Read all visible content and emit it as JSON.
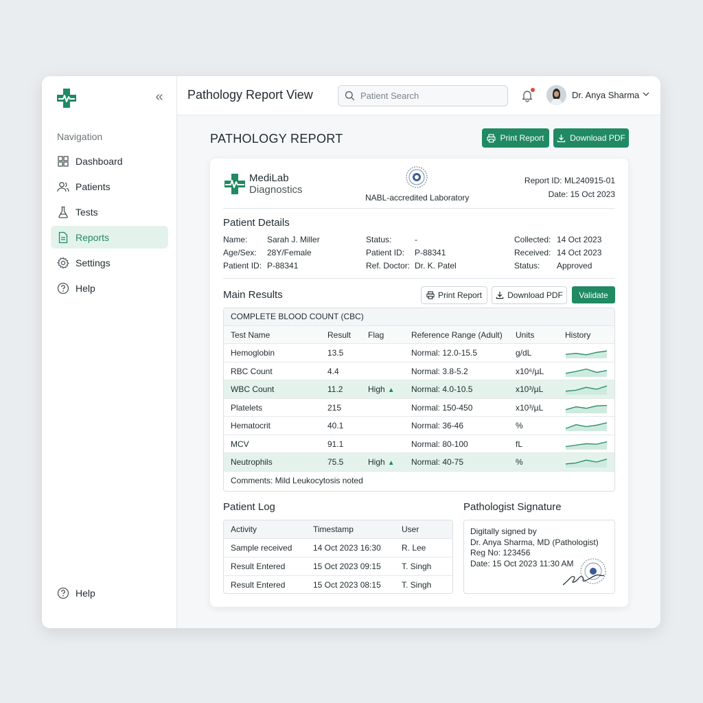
{
  "app": {
    "page_title": "Pathology Report View",
    "search_placeholder": "Patient Search",
    "user_name": "Dr. Anya Sharma",
    "accent_color": "#1f8a63"
  },
  "sidebar": {
    "heading": "Navigation",
    "items": [
      {
        "label": "Dashboard",
        "icon": "grid-icon"
      },
      {
        "label": "Patients",
        "icon": "users-icon"
      },
      {
        "label": "Tests",
        "icon": "flask-icon"
      },
      {
        "label": "Reports",
        "icon": "document-icon",
        "active": true
      },
      {
        "label": "Settings",
        "icon": "gear-icon"
      },
      {
        "label": "Help",
        "icon": "help-icon"
      }
    ],
    "footer_help": "Help"
  },
  "report": {
    "heading": "PATHOLOGY REPORT",
    "print_label": "Print Report",
    "download_label": "Download PDF",
    "lab_name_1": "MediLab",
    "lab_name_2": "Diagnostics",
    "accreditation": "NABL-accredited Laboratory",
    "report_id": "Report ID: ML240915-01",
    "date": "Date: 15 Oct 2023"
  },
  "patient": {
    "title": "Patient Details",
    "col1": [
      {
        "k": "Name:",
        "v": "Sarah J. Miller"
      },
      {
        "k": "Age/Sex:",
        "v": "28Y/Female"
      },
      {
        "k": "Patient ID:",
        "v": "P-88341"
      }
    ],
    "col2": [
      {
        "k": "Status:",
        "v": "-"
      },
      {
        "k": "Patient ID:",
        "v": "P-88341"
      },
      {
        "k": "Ref. Doctor:",
        "v": "Dr. K. Patel"
      }
    ],
    "col3": [
      {
        "k": "Collected:",
        "v": "14 Oct 2023"
      },
      {
        "k": "Received:",
        "v": "14 Oct 2023"
      },
      {
        "k": "Status:",
        "v": "Approved"
      }
    ]
  },
  "results": {
    "title": "Main Results",
    "print_label": "Print Report",
    "download_label": "Download PDF",
    "validate_label": "Validate",
    "panel_title": "COMPLETE BLOOD COUNT (CBC)",
    "headers": [
      "Test Name",
      "Result",
      "Flag",
      "Reference Range (Adult)",
      "Units",
      "History"
    ],
    "rows": [
      {
        "name": "Hemoglobin",
        "result": "13.5",
        "flag": "",
        "range": "Normal: 12.0-15.5",
        "units": "g/dL",
        "highlight": false,
        "history": [
          0.35,
          0.45,
          0.3,
          0.55,
          0.7
        ]
      },
      {
        "name": "RBC Count",
        "result": "4.4",
        "flag": "",
        "range": "Normal: 3.8-5.2",
        "units": "x10⁶/µL",
        "highlight": false,
        "history": [
          0.3,
          0.5,
          0.75,
          0.4,
          0.6
        ]
      },
      {
        "name": "WBC Count",
        "result": "11.2",
        "flag": "High",
        "range": "Normal: 4.0-10.5",
        "units": "x10³/µL",
        "highlight": true,
        "history": [
          0.3,
          0.4,
          0.7,
          0.5,
          0.85
        ]
      },
      {
        "name": "Platelets",
        "result": "215",
        "flag": "",
        "range": "Normal: 150-450",
        "units": "x10³/µL",
        "highlight": false,
        "history": [
          0.3,
          0.6,
          0.45,
          0.7,
          0.75
        ]
      },
      {
        "name": "Hematocrit",
        "result": "40.1",
        "flag": "",
        "range": "Normal: 36-46",
        "units": "%",
        "highlight": false,
        "history": [
          0.2,
          0.6,
          0.4,
          0.55,
          0.8
        ]
      },
      {
        "name": "MCV",
        "result": "91.1",
        "flag": "",
        "range": "Normal: 80-100",
        "units": "fL",
        "highlight": false,
        "history": [
          0.25,
          0.4,
          0.55,
          0.5,
          0.75
        ]
      },
      {
        "name": "Neutrophils",
        "result": "75.5",
        "flag": "High",
        "range": "Normal: 40-75",
        "units": "%",
        "highlight": true,
        "history": [
          0.3,
          0.4,
          0.7,
          0.5,
          0.8
        ]
      }
    ],
    "comments": "Comments: Mild Leukocytosis noted"
  },
  "log": {
    "title": "Patient Log",
    "headers": [
      "Activity",
      "Timestamp",
      "User"
    ],
    "rows": [
      {
        "activity": "Sample received",
        "timestamp": "14 Oct 2023 16:30",
        "user": "R. Lee"
      },
      {
        "activity": "Result Entered",
        "timestamp": "15 Oct 2023 09:15",
        "user": "T. Singh"
      },
      {
        "activity": "Result Entered",
        "timestamp": "15 Oct 2023 08:15",
        "user": "T. Singh"
      }
    ]
  },
  "signature": {
    "title": "Pathologist Signature",
    "line1": "Digitally signed by",
    "line2": "Dr. Anya Sharma, MD (Pathologist)",
    "line3": "Reg No: 123456",
    "line4": "Date: 15 Oct 2023 11:30 AM"
  }
}
